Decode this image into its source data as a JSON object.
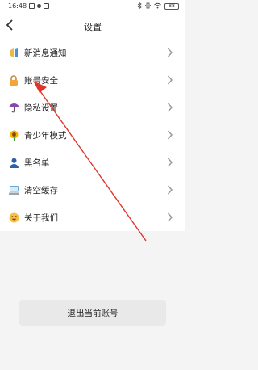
{
  "status_bar": {
    "time": "16:48",
    "battery": "88"
  },
  "header": {
    "title": "设置"
  },
  "menu": [
    {
      "label": "新消息通知",
      "icon": "bell-icon",
      "color": "#e9b949"
    },
    {
      "label": "账号安全",
      "icon": "lock-icon",
      "color": "#f2a63a"
    },
    {
      "label": "隐私设置",
      "icon": "umbrella-icon",
      "color": "#8e44ad"
    },
    {
      "label": "青少年模式",
      "icon": "sunflower-icon",
      "color": "#f5b400"
    },
    {
      "label": "黑名单",
      "icon": "person-icon",
      "color": "#2f5fa8"
    },
    {
      "label": "清空缓存",
      "icon": "computer-icon",
      "color": "#6aa6d8"
    },
    {
      "label": "关于我们",
      "icon": "smiley-icon",
      "color": "#f5c043"
    }
  ],
  "logout": {
    "label": "退出当前账号"
  },
  "colors": {
    "background": "#f4f4f4",
    "annotation_arrow": "#e0352b"
  }
}
